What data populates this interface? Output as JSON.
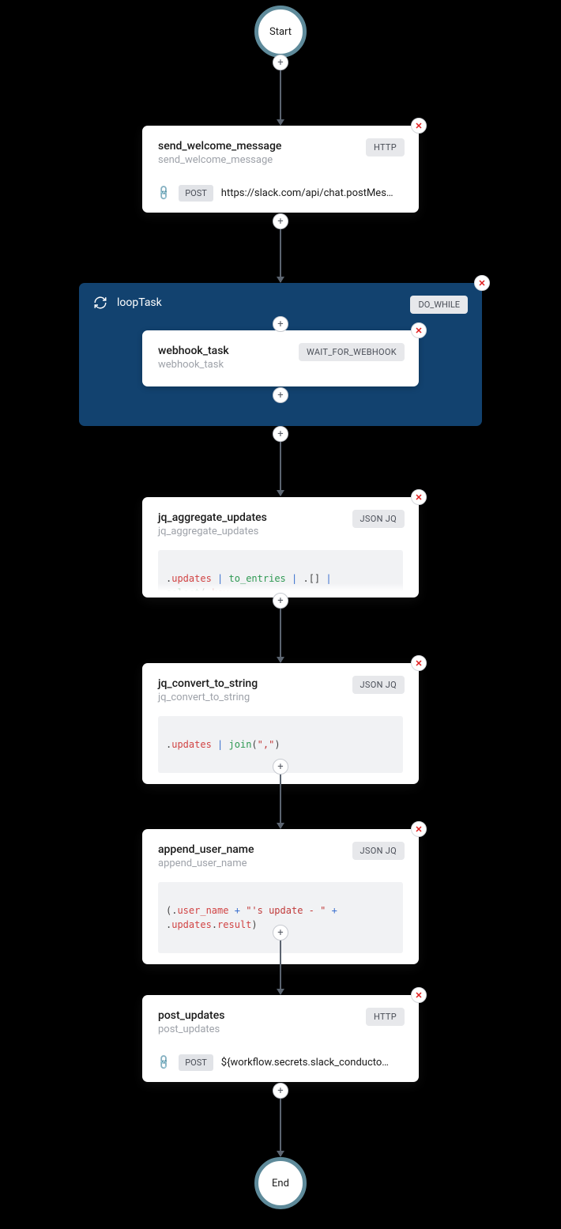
{
  "start": {
    "label": "Start"
  },
  "end": {
    "label": "End"
  },
  "tasks": {
    "send_welcome": {
      "title": "send_welcome_message",
      "subtitle": "send_welcome_message",
      "badge": "HTTP",
      "method": "POST",
      "url": "https://slack.com/api/chat.postMes…"
    },
    "loop": {
      "title": "loopTask",
      "badge": "DO_WHILE",
      "inner": {
        "title": "webhook_task",
        "subtitle": "webhook_task",
        "badge": "WAIT_FOR_WEBHOOK"
      }
    },
    "jq_aggregate": {
      "title": "jq_aggregate_updates",
      "subtitle": "jq_aggregate_updates",
      "badge": "JSON JQ"
    },
    "jq_convert": {
      "title": "jq_convert_to_string",
      "subtitle": "jq_convert_to_string",
      "badge": "JSON JQ"
    },
    "append_user": {
      "title": "append_user_name",
      "subtitle": "append_user_name",
      "badge": "JSON JQ"
    },
    "post_updates": {
      "title": "post_updates",
      "subtitle": "post_updates",
      "badge": "HTTP",
      "method": "POST",
      "url": "${workflow.secrets.slack_conducto…"
    }
  },
  "code": {
    "jq_aggregate_tokens": ".updates | to_entries | .[] | select(.key != \"iteration\") | .value | .webhook_task.event.text | select(. !=",
    "jq_convert_tokens": ".updates | join(\",\")",
    "append_user_tokens": "(.user_name + \"'s update - \" + .updates.result)"
  }
}
